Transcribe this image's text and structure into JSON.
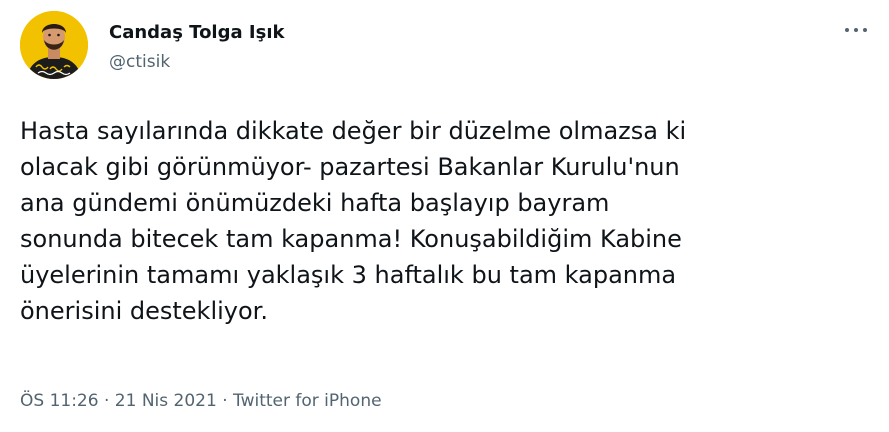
{
  "author": {
    "display_name": "Candaş Tolga Işık",
    "handle": "@ctisik",
    "avatar_icon": "profile-photo",
    "avatar_background": "#f2c200"
  },
  "more_icon": "more-horizontal-icon",
  "tweet": {
    "text": "Hasta sayılarında dikkate değer bir düzelme olmazsa ki\nolacak gibi görünmüyor- pazartesi Bakanlar Kurulu'nun\nana gündemi önümüzdeki hafta başlayıp bayram\nsonunda bitecek tam kapanma! Konuşabildiğim Kabine\nüyelerinin tamamı yaklaşık 3 haftalık bu tam kapanma\nönerisini destekliyor."
  },
  "meta": {
    "time": "ÖS 11:26",
    "separator": "·",
    "date": "21 Nis 2021",
    "source": "Twitter for iPhone"
  },
  "colors": {
    "text_primary": "#0f1419",
    "text_secondary": "#536471"
  }
}
